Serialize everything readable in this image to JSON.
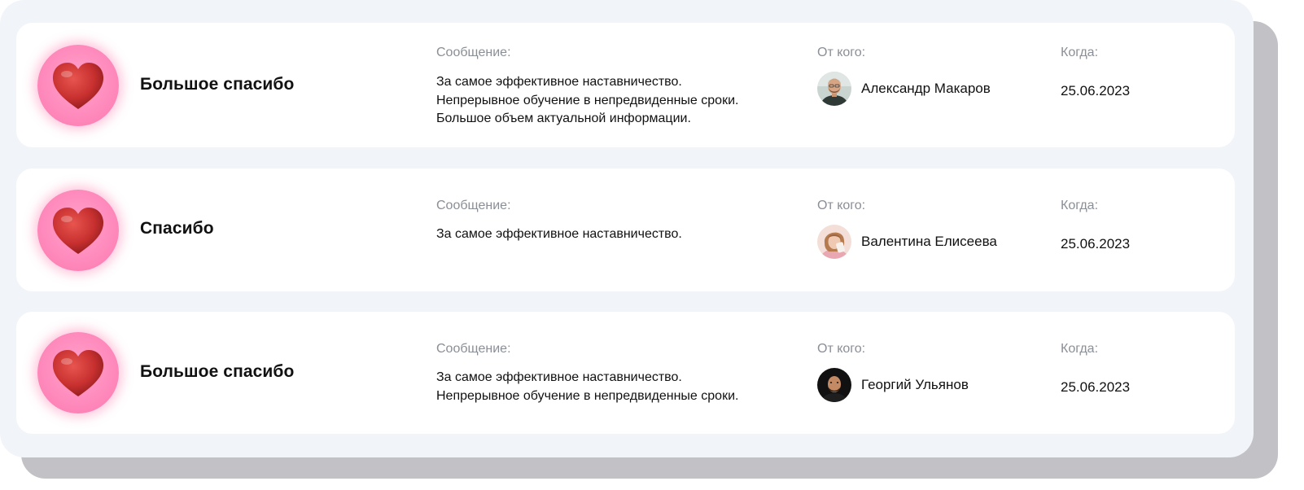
{
  "labels": {
    "message": "Сообщение:",
    "from": "От кого:",
    "when": "Когда:"
  },
  "colors": {
    "heart_badge": "#ff8bbd",
    "heart": "#c7302f",
    "panel_bg": "#f1f4f9",
    "card_bg": "#ffffff",
    "label_text": "#8a8e96"
  },
  "icons": {
    "award": "heart-icon"
  },
  "awards": [
    {
      "title": "Большое спасибо",
      "message_lines": [
        "За самое эффективное наставничество.",
        "Непрерывное обучение в непредвиденные сроки.",
        "Большое объем актуальной информации."
      ],
      "sender": "Александр Макаров",
      "date": "25.06.2023"
    },
    {
      "title": "Спасибо",
      "message_lines": [
        "За самое эффективное наставничество."
      ],
      "sender": "Валентина Елисеева",
      "date": "25.06.2023"
    },
    {
      "title": "Большое спасибо",
      "message_lines": [
        "За самое эффективное наставничество.",
        "Непрерывное обучение в непредвиденные сроки."
      ],
      "sender": "Георгий Ульянов",
      "date": "25.06.2023"
    }
  ]
}
